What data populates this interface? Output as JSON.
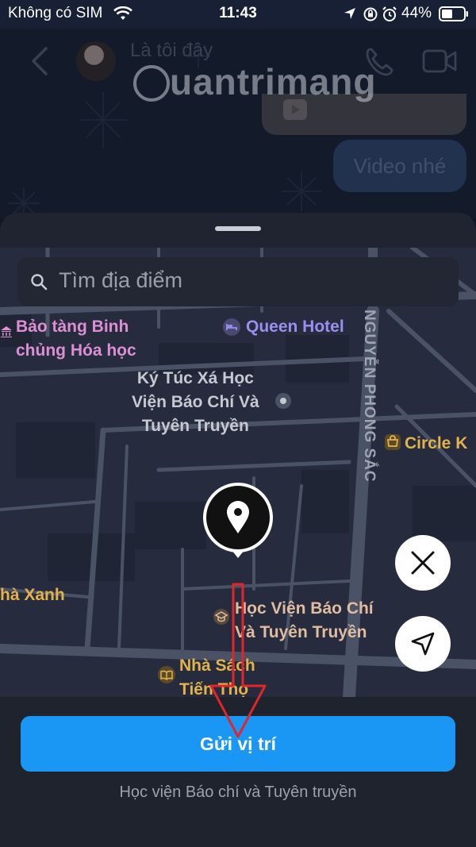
{
  "status_bar": {
    "carrier": "Không có SIM",
    "time": "11:43",
    "battery": "44%"
  },
  "chat": {
    "contact_name": "Là tôi đây",
    "message_text": "Video nhé",
    "watermark": "uantrimang"
  },
  "search": {
    "placeholder": "Tìm địa điểm"
  },
  "map": {
    "pois": {
      "museum": "Bảo tàng Binh\nchủng Hóa học",
      "hotel": "Queen Hotel",
      "dorm": "Ký Túc Xá Học\nViện Báo Chí Và\nTuyên Truyền",
      "circle_k": "Circle K",
      "xanh": "hà Xanh",
      "academy": "Học Viện Báo Chí\nVà Tuyên Truyền",
      "bookstore": "Nhà Sách\nTiến Thọ"
    },
    "street_name": "NGUYỄN PHONG SẮC"
  },
  "actions": {
    "send_location_label": "Gửi vị trí",
    "selected_place": "Học viện Báo chí và Tuyên truyền"
  },
  "colors": {
    "accent": "#1a96f4",
    "annotation_arrow": "#e0262b"
  }
}
